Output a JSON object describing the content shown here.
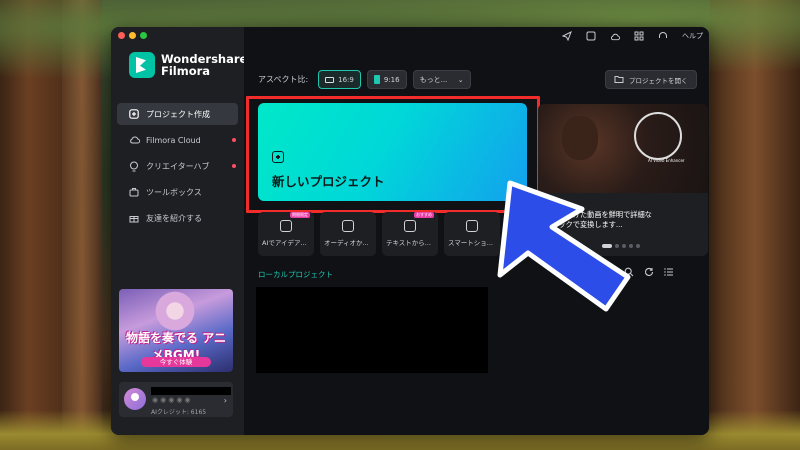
{
  "window": {
    "brand_line1": "Wondershare",
    "brand_line2": "Filmora"
  },
  "sidebar": {
    "items": [
      {
        "label": "プロジェクト作成",
        "icon": "plus-square-icon",
        "active": true,
        "dot": false
      },
      {
        "label": "Filmora Cloud",
        "icon": "cloud-icon",
        "active": false,
        "dot": true
      },
      {
        "label": "クリエイターハブ",
        "icon": "bulb-icon",
        "active": false,
        "dot": true
      },
      {
        "label": "ツールボックス",
        "icon": "toolbox-icon",
        "active": false,
        "dot": false
      },
      {
        "label": "友達を紹介する",
        "icon": "gift-icon",
        "active": false,
        "dot": false
      }
    ],
    "promo_title": "物語を奏でる アニメBGM!",
    "promo_button": "今すぐ体験",
    "account_credits": "AIクレジット: 6165"
  },
  "topbar": {
    "icons": [
      "send-icon",
      "media-icon",
      "cloud-upload-icon",
      "grid-icon",
      "headset-icon"
    ],
    "help": "ヘルプ"
  },
  "aspect": {
    "label": "アスペクト比:",
    "options": [
      {
        "label": "16:9",
        "selected": false
      },
      {
        "label": "9:16",
        "selected": true
      },
      {
        "label": "もっと...",
        "selected": false
      }
    ]
  },
  "open_project": "プロジェクトを開く",
  "new_project": "新しいプロジェクト",
  "banner": {
    "tag": "AI Video Enhancer",
    "text_line1": "し、ぼやけた動画を鮮明で詳細な",
    "text_line2": "クリックで変換します..."
  },
  "tools": [
    {
      "label": "AIでアイデア...",
      "badge": "期間限定"
    },
    {
      "label": "オーディオか...",
      "badge": ""
    },
    {
      "label": "テキストから...",
      "badge": "おすすめ"
    },
    {
      "label": "スマートショ...",
      "badge": ""
    }
  ],
  "local": {
    "label": "ローカルプロジェクト"
  },
  "colors": {
    "accent": "#1ec7b0",
    "highlight": "#f22b2b",
    "arrow": "#2d4de8"
  }
}
